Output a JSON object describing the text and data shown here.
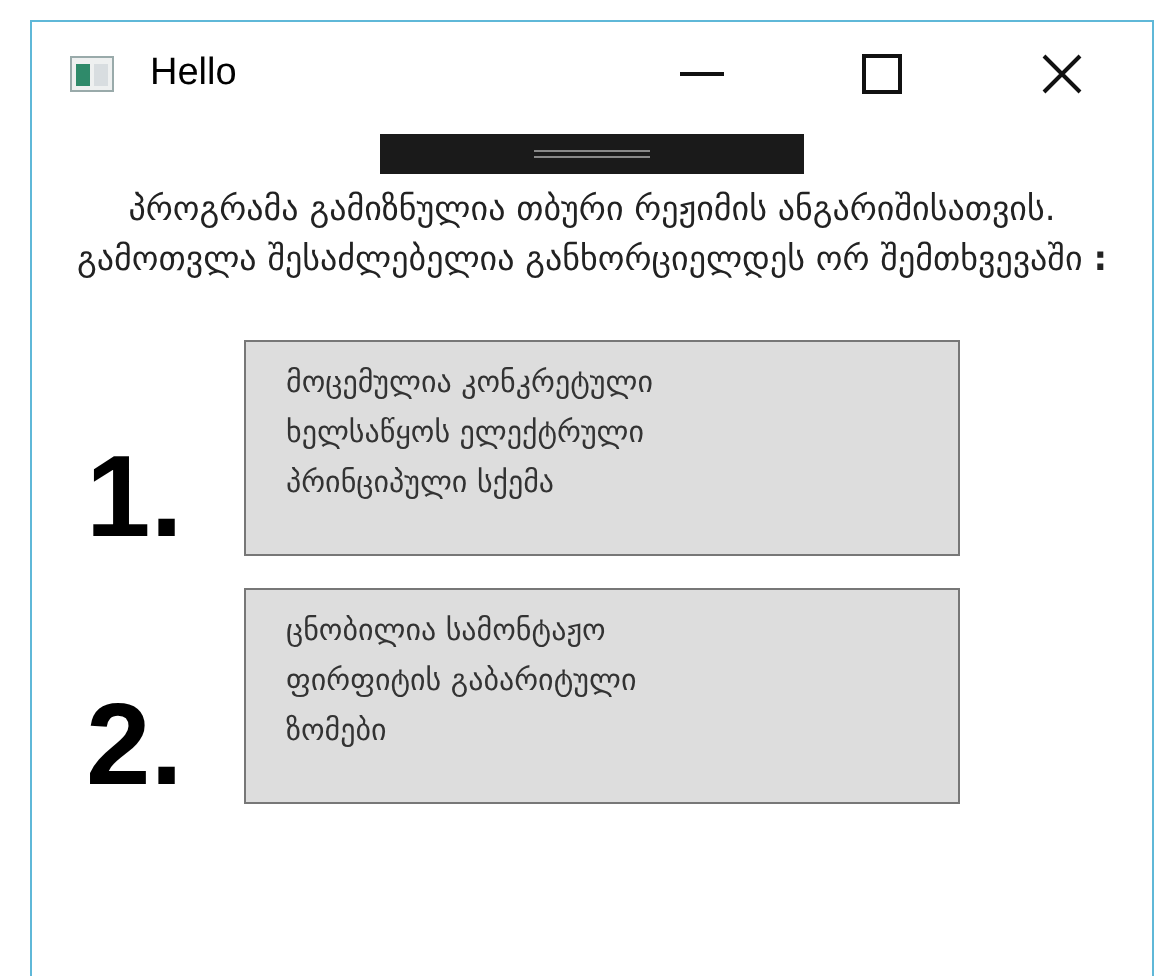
{
  "window": {
    "title": "Hello"
  },
  "intro": "პროგრამა გამიზნულია თბური რეჟიმის ანგარიშისათვის. გამოთვლა შესაძლებელია განხორციელდეს ორ შემთხვევაში **:**",
  "options": [
    {
      "number": "1.",
      "lines": [
        "მოცემულია კონკრეტული",
        "ხელსაწყოს ელექტრული",
        "პრინციპული სქემა"
      ]
    },
    {
      "number": "2.",
      "lines": [
        "ცნობილია სამონტაჟო",
        "ფირფიტის გაბარიტული",
        "ზომები"
      ]
    }
  ]
}
